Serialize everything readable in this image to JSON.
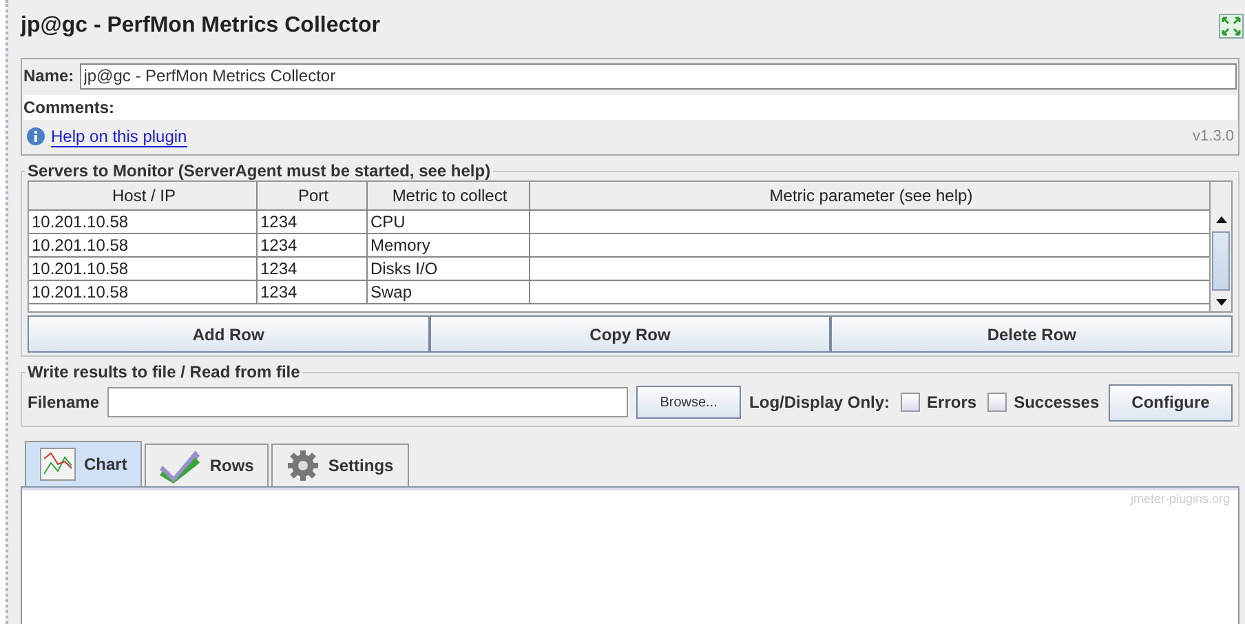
{
  "title": "jp@gc - PerfMon Metrics Collector",
  "name": {
    "label": "Name:",
    "value": "jp@gc - PerfMon Metrics Collector"
  },
  "comments": {
    "label": "Comments:"
  },
  "help": {
    "link": "Help on this plugin",
    "version": "v1.3.0"
  },
  "servers": {
    "title": "Servers to Monitor (ServerAgent must be started, see help)",
    "columns": [
      "Host / IP",
      "Port",
      "Metric to collect",
      "Metric parameter (see help)"
    ],
    "rows": [
      [
        "10.201.10.58",
        "1234",
        "CPU"
      ],
      [
        "10.201.10.58",
        "1234",
        "Memory"
      ],
      [
        "10.201.10.58",
        "1234",
        "Disks I/O"
      ],
      [
        "10.201.10.58",
        "1234",
        "Swap"
      ]
    ],
    "buttons": [
      "Add Row",
      "Copy Row",
      "Delete Row"
    ]
  },
  "file": {
    "title": "Write results to file / Read from file",
    "label": "Filename",
    "browse": "Browse...",
    "log_label": "Log/Display Only:",
    "checks": [
      {
        "label": "Errors",
        "checked": false
      },
      {
        "label": "Successes",
        "checked": false
      }
    ],
    "configure": "Configure"
  },
  "tabs": [
    {
      "label": "Chart",
      "kind": "chart",
      "selected": true
    },
    {
      "label": "Rows",
      "kind": "rows",
      "selected": false
    },
    {
      "label": "Settings",
      "kind": "settings",
      "selected": false
    }
  ],
  "chart_watermark": "jmeter-plugins.org"
}
